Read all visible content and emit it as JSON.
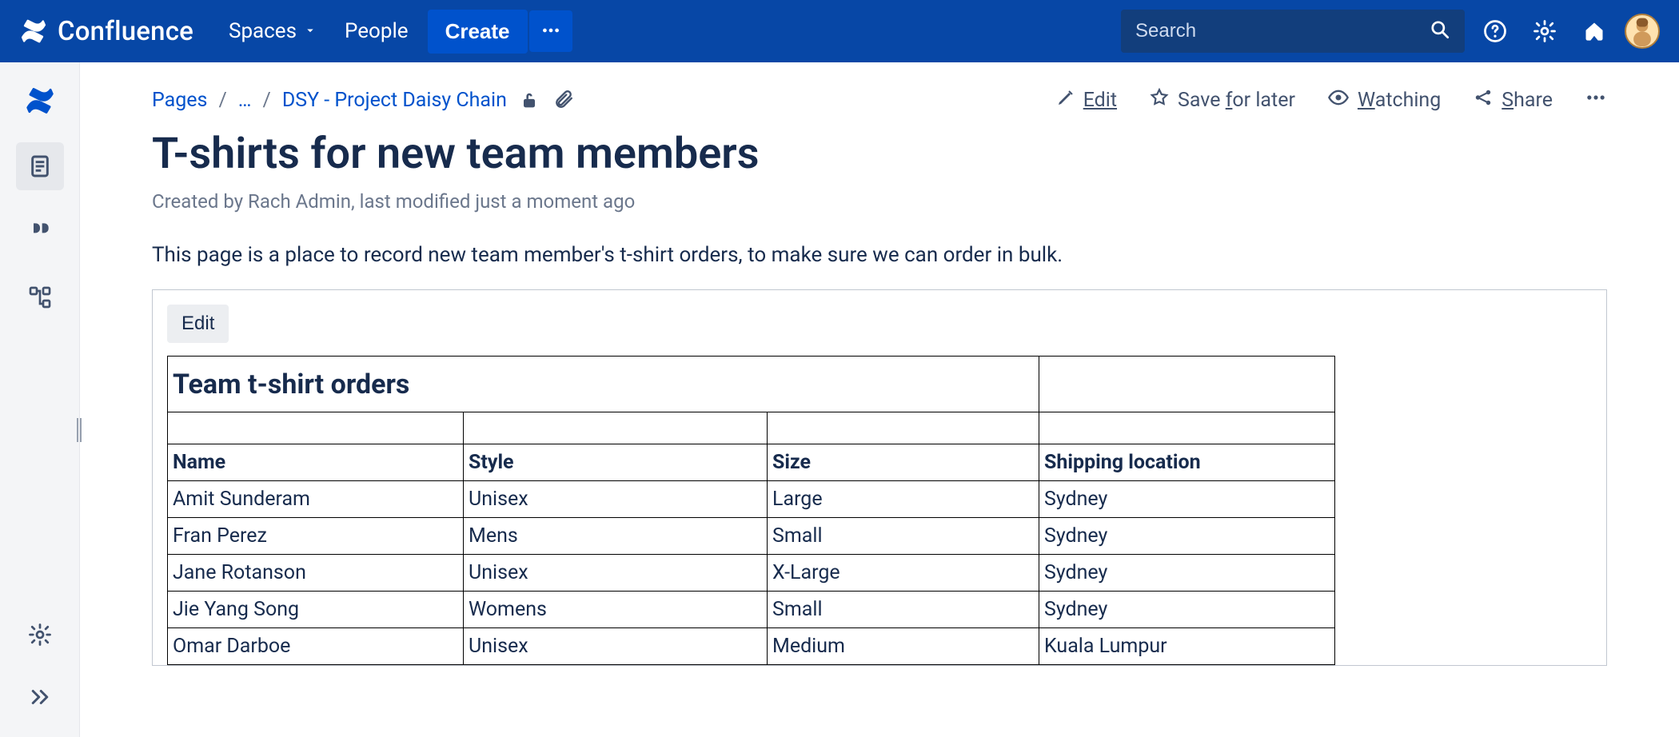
{
  "nav": {
    "brand": "Confluence",
    "spaces": "Spaces",
    "people": "People",
    "create": "Create",
    "search_placeholder": "Search"
  },
  "breadcrumbs": {
    "pages": "Pages",
    "ellipsis": "…",
    "parent": "DSY - Project Daisy Chain"
  },
  "actions": {
    "edit": "Edit",
    "save": "Save for later",
    "watching": "Watching",
    "share": "Share"
  },
  "page": {
    "title": "T-shirts for new team members",
    "byline": "Created by Rach Admin, last modified just a moment ago",
    "intro": "This page is a place to record new team member's t-shirt orders, to make sure we can order in bulk."
  },
  "embed": {
    "edit_label": "Edit",
    "sheet_title": "Team t-shirt orders",
    "columns": [
      "Name",
      "Style",
      "Size",
      "Shipping location"
    ],
    "rows": [
      [
        "Amit Sunderam",
        "Unisex",
        "Large",
        "Sydney"
      ],
      [
        "Fran Perez",
        "Mens",
        "Small",
        "Sydney"
      ],
      [
        "Jane Rotanson",
        "Unisex",
        "X-Large",
        "Sydney"
      ],
      [
        "Jie Yang Song",
        "Womens",
        "Small",
        "Sydney"
      ],
      [
        "Omar Darboe",
        "Unisex",
        "Medium",
        "Kuala Lumpur"
      ]
    ]
  }
}
